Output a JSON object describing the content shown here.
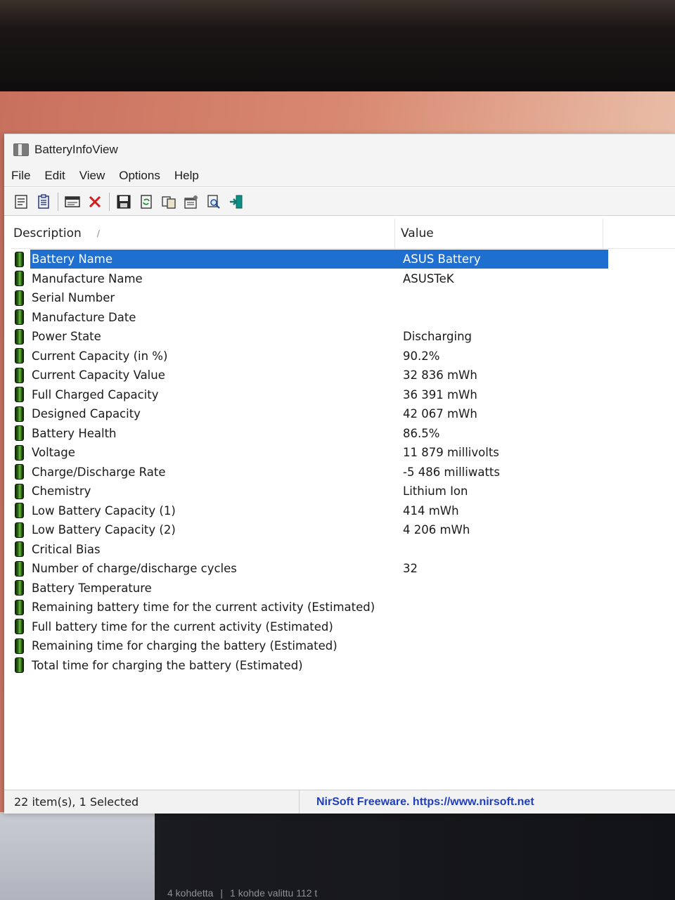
{
  "app": {
    "title": "BatteryInfoView"
  },
  "menu": [
    "File",
    "Edit",
    "View",
    "Options",
    "Help"
  ],
  "toolbar": {
    "buttons": [
      "properties-icon",
      "report-icon",
      "html-report-icon",
      "delete-icon",
      "save-icon",
      "refresh-icon",
      "copy-icon",
      "options-icon",
      "find-icon",
      "exit-icon"
    ]
  },
  "list": {
    "columns": {
      "description": "Description",
      "value": "Value"
    },
    "selected_index": 0,
    "rows": [
      {
        "description": "Battery Name",
        "value": "ASUS Battery"
      },
      {
        "description": "Manufacture Name",
        "value": "ASUSTeK"
      },
      {
        "description": "Serial Number",
        "value": ""
      },
      {
        "description": "Manufacture Date",
        "value": ""
      },
      {
        "description": "Power State",
        "value": "Discharging"
      },
      {
        "description": "Current Capacity (in %)",
        "value": "90.2%"
      },
      {
        "description": "Current Capacity Value",
        "value": "32 836 mWh"
      },
      {
        "description": "Full Charged Capacity",
        "value": "36 391 mWh"
      },
      {
        "description": "Designed Capacity",
        "value": "42 067 mWh"
      },
      {
        "description": "Battery Health",
        "value": "86.5%"
      },
      {
        "description": "Voltage",
        "value": "11 879 millivolts"
      },
      {
        "description": "Charge/Discharge Rate",
        "value": "-5 486 milliwatts"
      },
      {
        "description": "Chemistry",
        "value": "Lithium Ion"
      },
      {
        "description": "Low Battery Capacity (1)",
        "value": "414 mWh"
      },
      {
        "description": "Low Battery Capacity (2)",
        "value": "4 206 mWh"
      },
      {
        "description": "Critical Bias",
        "value": ""
      },
      {
        "description": "Number of charge/discharge cycles",
        "value": "32"
      },
      {
        "description": "Battery Temperature",
        "value": ""
      },
      {
        "description": "Remaining battery time for the current activity (Estimated)",
        "value": ""
      },
      {
        "description": "Full battery time for the current activity (Estimated)",
        "value": ""
      },
      {
        "description": "Remaining time for charging the battery (Estimated)",
        "value": ""
      },
      {
        "description": "Total  time for charging the battery (Estimated)",
        "value": ""
      }
    ]
  },
  "statusbar": {
    "items": "22 item(s), 1 Selected",
    "link": "NirSoft Freeware. https://www.nirsoft.net"
  },
  "background": {
    "explorer_status_left": "4 kohdetta",
    "explorer_status_right": "1 kohde valittu 112 t"
  },
  "colors": {
    "selection": "#1f6fd1",
    "link": "#1f3fbf",
    "battery_icon": "#2f6b1a"
  }
}
